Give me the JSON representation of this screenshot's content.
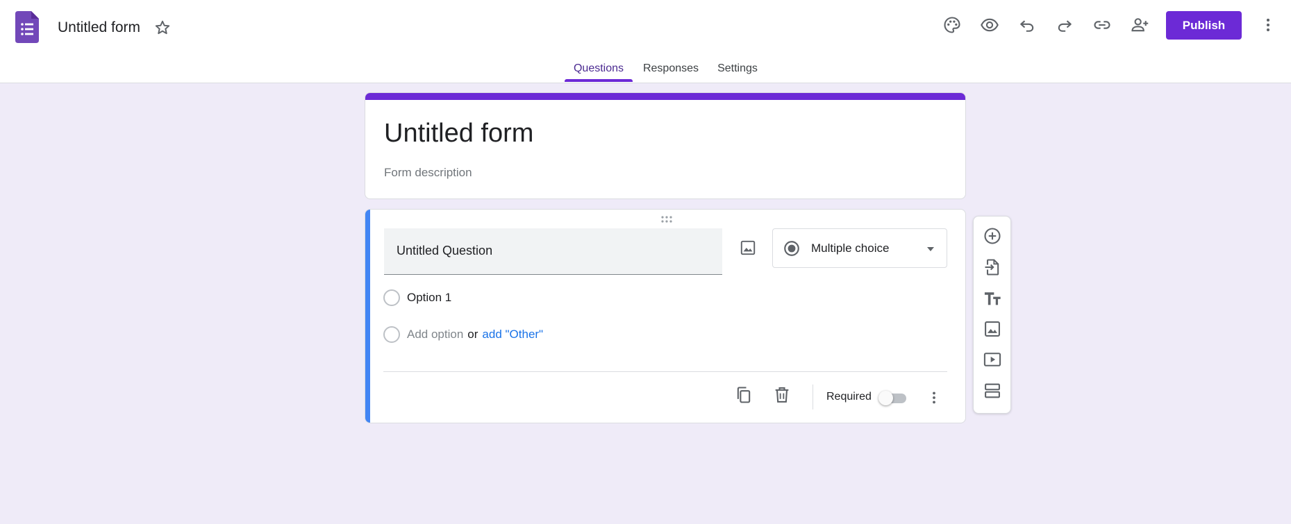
{
  "header": {
    "doc_title": "Untitled form",
    "publish_label": "Publish",
    "icons": [
      "palette-icon",
      "preview-eye-icon",
      "undo-icon",
      "redo-icon",
      "link-icon",
      "add-collaborator-icon",
      "more-vert-icon"
    ]
  },
  "tabs": [
    {
      "label": "Questions",
      "active": true
    },
    {
      "label": "Responses",
      "active": false
    },
    {
      "label": "Settings",
      "active": false
    }
  ],
  "form": {
    "title": "Untitled form",
    "description_placeholder": "Form description"
  },
  "question": {
    "title": "Untitled Question",
    "type": "Multiple choice",
    "options": [
      "Option 1"
    ],
    "add_option": "Add option",
    "or": "or",
    "add_other": "add \"Other\"",
    "required_label": "Required",
    "required": false
  },
  "toolbar": {
    "items": [
      "add-question-icon",
      "import-questions-icon",
      "add-title-icon",
      "add-image-icon",
      "add-video-icon",
      "add-section-icon"
    ]
  },
  "colors": {
    "brand": "#6c2ad6",
    "active_question_accent": "#4285f4",
    "background": "#efebf8",
    "link": "#1a73e8"
  }
}
